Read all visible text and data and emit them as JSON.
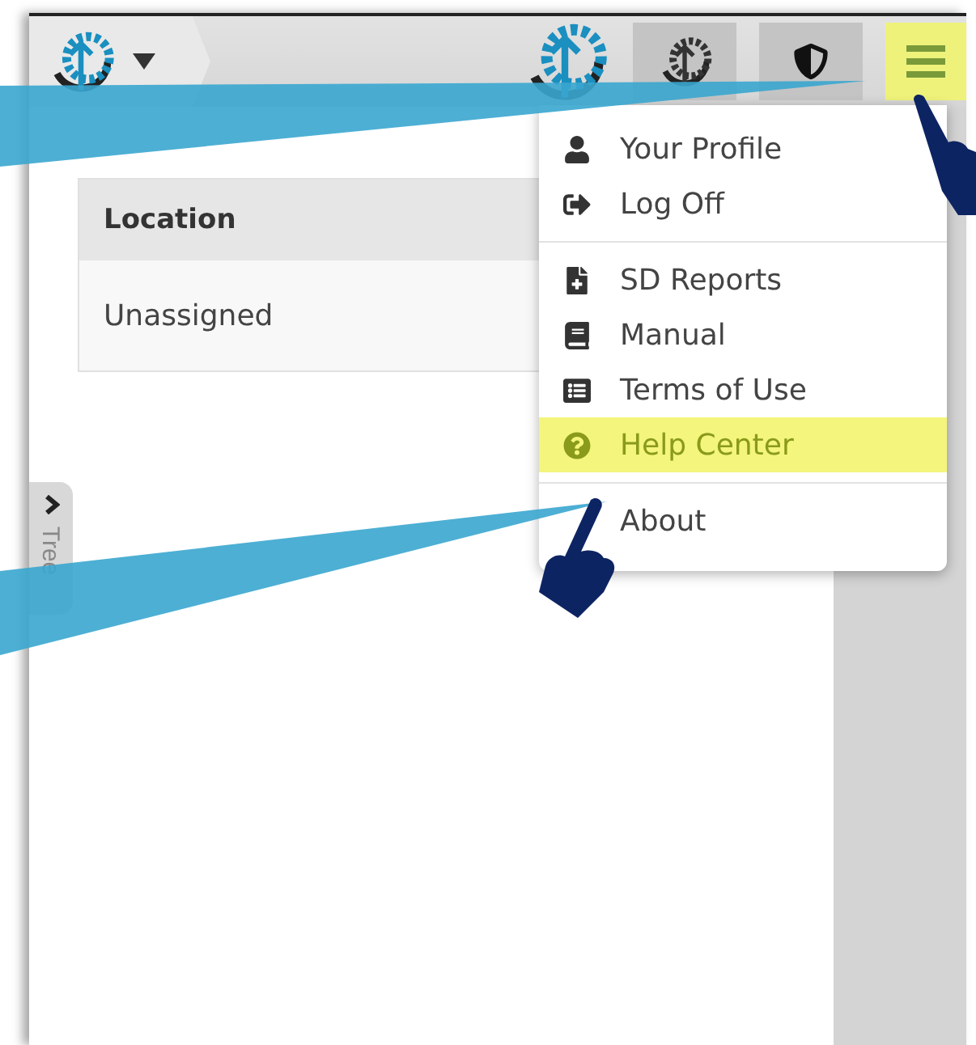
{
  "header": {
    "hamburger": {
      "highlighted": true
    }
  },
  "table": {
    "columns": [
      "Location"
    ],
    "rows": [
      [
        "Unassigned"
      ]
    ]
  },
  "tree_tab": {
    "label": "Tree"
  },
  "menu": {
    "sections": [
      [
        {
          "label": "Your Profile",
          "highlighted": false
        },
        {
          "label": "Log Off",
          "highlighted": false
        }
      ],
      [
        {
          "label": "SD Reports",
          "highlighted": false
        },
        {
          "label": "Manual",
          "highlighted": false
        },
        {
          "label": "Terms of Use",
          "highlighted": false
        },
        {
          "label": "Help Center",
          "highlighted": true
        }
      ],
      [
        {
          "label": "About",
          "highlighted": false
        }
      ]
    ]
  }
}
